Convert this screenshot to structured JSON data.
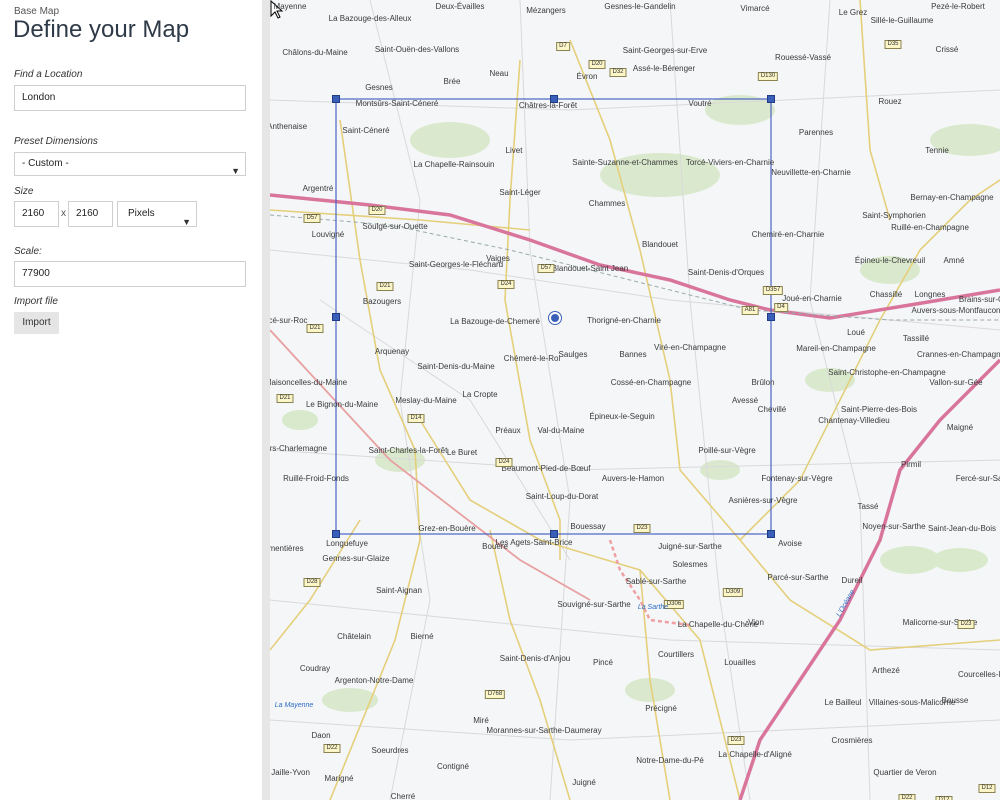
{
  "panel": {
    "eyebrow": "Base Map",
    "title": "Define your Map",
    "location_label": "Find a Location",
    "location_value": "London",
    "preset_label": "Preset Dimensions",
    "preset_value": "- Custom -",
    "size_label": "Size",
    "width": "2160",
    "height": "2160",
    "times": "x",
    "unit": "Pixels",
    "scale_label": "Scale:",
    "scale_value": "77900",
    "import_label": "Import file",
    "import_button": "Import"
  },
  "map": {
    "towns": [
      "Mayenne",
      "La Bazouge-des-Alleux",
      "Deux-Évailles",
      "Mézangers",
      "Gesnes-le-Gandelin",
      "Vimarcé",
      "Le Grez",
      "Sillé-le-Guillaume",
      "Pezé-le-Robert",
      "Châlons-du-Maine",
      "Saint-Ouën-des-Vallons",
      "Neau",
      "Évron",
      "Saint-Georges-sur-Erve",
      "Assé-le-Bérenger",
      "Rouessé-Vassé",
      "Crissé",
      "Gesnes",
      "Brée",
      "Montsûrs-Saint-Céneré",
      "Châtres-la-Forêt",
      "Voutré",
      "Rouez",
      "Saint-Céneré",
      "Chapelle-Anthenaise",
      "Parennes",
      "Livet",
      "Tennie",
      "La Chapelle-Rainsouin",
      "Sainte-Suzanne-et-Chammes",
      "Torcé-Viviers-en-Charnie",
      "Neuvillette-en-Charnie",
      "Argentré",
      "Saint-Léger",
      "Chammes",
      "Bernay-en-Champagne",
      "Saint-Symphorien",
      "Ruillé-en-Champagne",
      "Louvigné",
      "Soulgé-sur-Ouette",
      "Blandouet",
      "Chemiré-en-Charnie",
      "Vaiges",
      "Saint-Georges-le-Fléchard",
      "Blandouet-Saint Jean",
      "Saint-Denis-d'Orques",
      "Épineu-le-Chevreuil",
      "Amné",
      "Bazougers",
      "Joué-en-Charnie",
      "Chassillé",
      "Longnes",
      "Brains-sur-Gée",
      "Auvers-sous-Montfaucon",
      "Forcé-sur-Roc",
      "La Bazouge-de-Chemeré",
      "Thorigné-en-Charnie",
      "Loué",
      "Tassillé",
      "Arquenay",
      "Chémeré-le-Roi",
      "Saulges",
      "Bannes",
      "Viré-en-Champagne",
      "Mareil-en-Champagne",
      "Crannes-en-Champagne",
      "Maisoncelles-du-Maine",
      "Saint-Denis-du-Maine",
      "Cossé-en-Champagne",
      "Brûlon",
      "Saint-Christophe-en-Champagne",
      "Vallon-sur-Gée",
      "Le Bignon-du-Maine",
      "Meslay-du-Maine",
      "La Cropte",
      "Avessé",
      "Chevillé",
      "Saint-Pierre-des-Bois",
      "Préaux",
      "Val-du-Maine",
      "Épineux-le-Seguin",
      "Maigné",
      "Chantenay-Villedieu",
      "Villiers-Charlemagne",
      "Le Buret",
      "Poillé-sur-Vègre",
      "Pirmil",
      "Saint-Charles-la-Forêt",
      "Beaumont-Pied-de-Bœuf",
      "Auvers-le-Hamon",
      "Fontenay-sur-Vègre",
      "Fercé-sur-Sarthe",
      "Ruillé-Froid-Fonds",
      "Saint-Loup-du-Dorat",
      "Asnières-sur-Vègre",
      "Tassé",
      "Grez-en-Bouère",
      "Bouessay",
      "Noyen-sur-Sarthe",
      "Saint-Jean-du-Bois",
      "Fromentières",
      "Longuefuye",
      "Bouère",
      "Les Agets-Saint-Brice",
      "Juigné-sur-Sarthe",
      "Avoise",
      "Gennes-sur-Glaize",
      "Solesmes",
      "Sablé-sur-Sarthe",
      "Parcé-sur-Sarthe",
      "Dureil",
      "Saint-Aignan",
      "Souvigné-sur-Sarthe",
      "Vion",
      "La Chapelle-du-Chêne",
      "Malicorne-sur-Sarthe",
      "Châtelain",
      "Bierné",
      "Courtillers",
      "Pincé",
      "Louailles",
      "Coudray",
      "Saint-Denis-d'Anjou",
      "Arthezé",
      "Courcelles-la-Forêt",
      "Argenton-Notre-Dame",
      "Le Bailleul",
      "Villaines-sous-Malicorne",
      "Bousse",
      "Précigné",
      "Daon",
      "Miré",
      "Crosmières",
      "Soeurdres",
      "Morannes-sur-Sarthe-Daumeray",
      "Contigné",
      "Notre-Dame-du-Pé",
      "La Chapelle-d'Aligné",
      "La Jaille-Yvon",
      "Marigné",
      "Juigné",
      "Quartier de Veron",
      "Cherré"
    ],
    "roads": [
      "D7",
      "D20",
      "D32",
      "D130",
      "D35",
      "D24",
      "D57",
      "D20",
      "D21",
      "D357",
      "D4",
      "A81",
      "D57",
      "D14",
      "D21",
      "D21",
      "D24",
      "D23",
      "D309",
      "D306",
      "D28",
      "D22",
      "D768",
      "D23",
      "D23",
      "D12",
      "D12",
      "D22"
    ],
    "water": [
      "La Sarthe",
      "La Mayenne",
      "L'Océane"
    ]
  }
}
